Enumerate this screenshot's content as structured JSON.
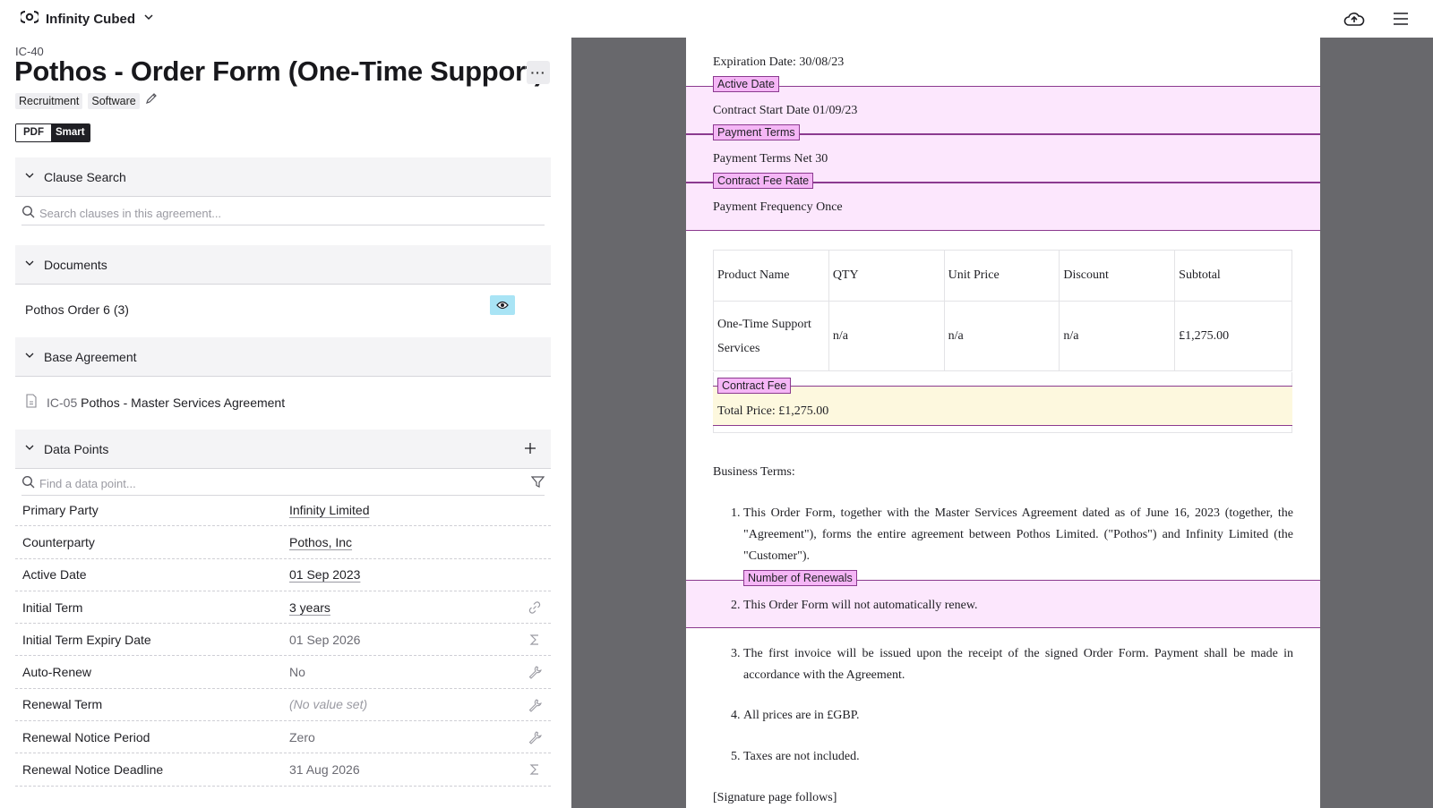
{
  "app": {
    "brand": "Infinity Cubed",
    "icons": [
      "logo-icon",
      "chevron-down-icon",
      "cloud-upload-icon",
      "menu-icon"
    ]
  },
  "header": {
    "doc_id": "IC-40",
    "title": "Pothos - Order Form (One-Time Support)",
    "more_label": "···",
    "tags": [
      "Recruitment",
      "Software"
    ],
    "view_toggle": {
      "pdf": "PDF",
      "smart": "Smart",
      "selected": "Smart"
    }
  },
  "clause_search": {
    "title": "Clause Search",
    "placeholder": "Search clauses in this agreement..."
  },
  "documents": {
    "title": "Documents",
    "items": [
      {
        "name": "Pothos Order 6 (3)"
      }
    ]
  },
  "base_agreement": {
    "title": "Base Agreement",
    "ref": "IC-05",
    "name": "Pothos - Master Services Agreement"
  },
  "data_points": {
    "title": "Data Points",
    "placeholder": "Find a data point...",
    "rows": [
      {
        "label": "Primary Party",
        "value": "Infinity Limited",
        "kind": "linked",
        "icon": ""
      },
      {
        "label": "Counterparty",
        "value": "Pothos, Inc",
        "kind": "linked",
        "icon": ""
      },
      {
        "label": "Active Date",
        "value": "01 Sep 2023",
        "kind": "linked",
        "icon": ""
      },
      {
        "label": "Initial Term",
        "value": "3 years",
        "kind": "linked",
        "icon": "link-icon"
      },
      {
        "label": "Initial Term Expiry Date",
        "value": "01 Sep 2026",
        "kind": "computed",
        "icon": "sigma-icon"
      },
      {
        "label": "Auto-Renew",
        "value": "No",
        "kind": "computed",
        "icon": "wrench-icon"
      },
      {
        "label": "Renewal Term",
        "value": "(No value set)",
        "kind": "empty",
        "icon": "wrench-icon"
      },
      {
        "label": "Renewal Notice Period",
        "value": "Zero",
        "kind": "computed",
        "icon": "wrench-icon"
      },
      {
        "label": "Renewal Notice Deadline",
        "value": "31 Aug 2026",
        "kind": "computed",
        "icon": "sigma-icon"
      }
    ]
  },
  "document_view": {
    "expiration": "Expiration Date: 30/08/23",
    "tags": {
      "active_date": "Active Date",
      "payment_terms": "Payment Terms",
      "contract_fee_rate": "Contract Fee Rate",
      "contract_fee": "Contract Fee",
      "renewals": "Number of Renewals"
    },
    "contract_start": "Contract Start Date 01/09/23",
    "payment_terms": "Payment Terms Net 30",
    "payment_frequency": "Payment Frequency Once",
    "table": {
      "headers": [
        "Product Name",
        "QTY",
        "Unit Price",
        "Discount",
        "Subtotal"
      ],
      "row": [
        "One-Time Support Services",
        "n/a",
        "n/a",
        "n/a",
        "£1,275.00"
      ]
    },
    "total": "Total Price: £1,275.00",
    "business_terms_heading": "Business Terms:",
    "terms": [
      "This Order Form, together with the Master Services Agreement dated as of June 16, 2023 (together, the \"Agreement\"), forms the entire agreement between Pothos Limited. (\"Pothos\") and Infinity Limited (the \"Customer\").",
      "This Order Form will not automatically renew.",
      "The first invoice will be issued upon the receipt of the signed Order Form. Payment shall be made in accordance with the Agreement.",
      "All prices are in £GBP.",
      "Taxes are not included."
    ],
    "signature": "[Signature page follows]"
  },
  "colors": {
    "highlight_band": "#fce7fd",
    "highlight_tag": "#f5b6f6",
    "highlight_border": "#8b3a8f",
    "total_highlight": "#fdf8de",
    "viewer_bg": "#68686c",
    "eye_button": "#a9e4f5"
  }
}
